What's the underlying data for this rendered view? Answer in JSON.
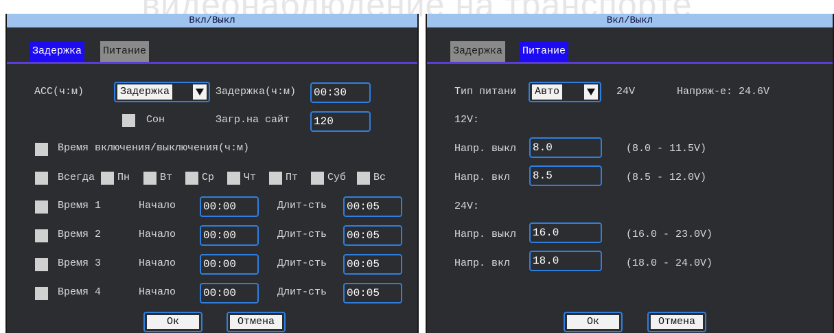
{
  "watermark": "видеонаблюдение на транспорте",
  "left": {
    "title": "Вкл/Выкл",
    "tabs": [
      "Задержка",
      "Питание"
    ],
    "acc_label": "ACC(ч:м)",
    "acc_select": "Задержка",
    "delay_label": "Задержка(ч:м)",
    "delay_value": "00:30",
    "sleep_label": "Сон",
    "upload_label": "Загр.на сайт",
    "upload_value": "120",
    "onoff_time_label": "Время включения/выключения(ч:м)",
    "days": [
      "Всегда",
      "Пн",
      "Вт",
      "Ср",
      "Чт",
      "Пт",
      "Суб",
      "Вс"
    ],
    "time_rows": [
      {
        "label": "Время 1",
        "start_label": "Начало",
        "start": "00:00",
        "dur_label": "Длит-сть",
        "dur": "00:05"
      },
      {
        "label": "Время 2",
        "start_label": "Начало",
        "start": "00:00",
        "dur_label": "Длит-сть",
        "dur": "00:05"
      },
      {
        "label": "Время 3",
        "start_label": "Начало",
        "start": "00:00",
        "dur_label": "Длит-сть",
        "dur": "00:05"
      },
      {
        "label": "Время 4",
        "start_label": "Начало",
        "start": "00:00",
        "dur_label": "Длит-сть",
        "dur": "00:05"
      }
    ],
    "ok": "Ок",
    "cancel": "Отмена"
  },
  "right": {
    "title": "Вкл/Выкл",
    "tabs": [
      "Задержка",
      "Питание"
    ],
    "power_type_label": "Тип питани",
    "power_type_value": "Авто",
    "power_nominal": "24V",
    "voltage_label": "Напряж-е: 24.6V",
    "section_12": "12V:",
    "off_label": "Напр. выкл",
    "on_label": "Напр. вкл",
    "v12_off": "8.0",
    "v12_off_range": "(8.0 - 11.5V)",
    "v12_on": "8.5",
    "v12_on_range": "(8.5 - 12.0V)",
    "section_24": "24V:",
    "v24_off": "16.0",
    "v24_off_range": "(16.0 - 23.0V)",
    "v24_on": "18.0",
    "v24_on_range": "(18.0 - 24.0V)",
    "ok": "Ок",
    "cancel": "Отмена"
  },
  "colors": {
    "panel_bg": "#2b2d30",
    "titlebar": "#9ec3ee",
    "tab_active": "#1d0bf2",
    "field_border": "#2f7fe0"
  }
}
